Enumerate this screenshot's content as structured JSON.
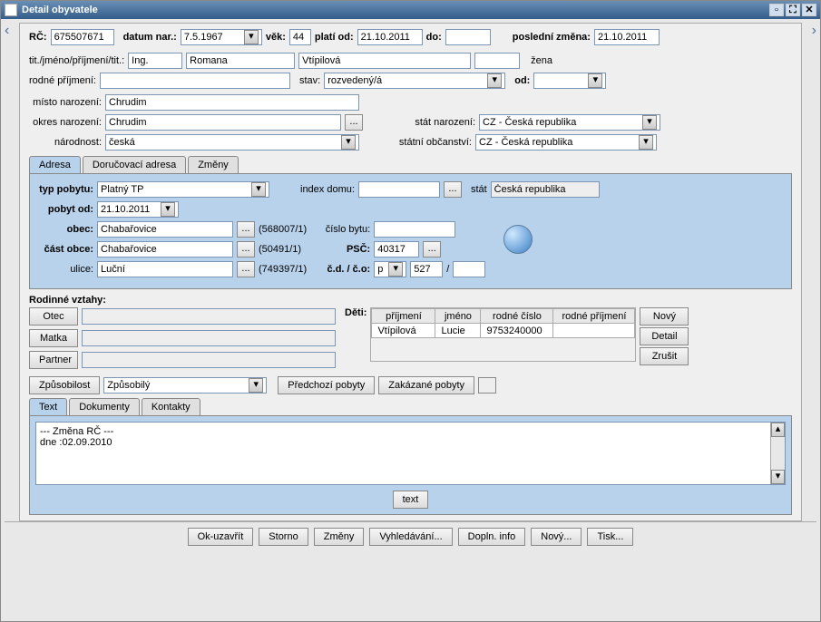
{
  "window": {
    "title": "Detail obyvatele"
  },
  "nav": {
    "left": "‹",
    "right": "›"
  },
  "fields": {
    "rc_label": "RČ:",
    "rc": "675507671",
    "dob_label": "datum nar.:",
    "dob": "7.5.1967",
    "age_label": "věk:",
    "age": "44",
    "valid_from_label": "platí od:",
    "valid_from": "21.10.2011",
    "to_label": "do:",
    "to": "",
    "last_change_label": "poslední změna:",
    "last_change": "21.10.2011",
    "name_label": "tit./jméno/příjmení/tit.:",
    "title_before": "Ing.",
    "first_name": "Romana",
    "surname": "Vtípilová",
    "title_after": "",
    "gender": "žena",
    "maiden_label": "rodné příjmení:",
    "maiden": "",
    "state_label": "stav:",
    "state": "rozvedený/á",
    "state_from_label": "od:",
    "state_from": "",
    "birthplace_label": "místo narození:",
    "birthplace": "Chrudim",
    "birth_district_label": "okres narození:",
    "birth_district": "Chrudim",
    "birth_country_label": "stát narození:",
    "birth_country": "CZ - Česká republika",
    "nationality_label": "národnost:",
    "nationality": "česká",
    "citizenship_label": "státní občanství:",
    "citizenship": "CZ - Česká republika"
  },
  "tabs1": {
    "adresa": "Adresa",
    "dorucovaci": "Doručovací adresa",
    "zmeny": "Změny"
  },
  "addr": {
    "typ_label": "typ pobytu:",
    "typ": "Platný TP",
    "index_label": "index domu:",
    "index": "",
    "stat_label": "stát",
    "stat": "Česká republika",
    "pobyt_od_label": "pobyt od:",
    "pobyt_od": "21.10.2011",
    "obec_label": "obec:",
    "obec": "Chabařovice",
    "obec_code": "(568007/1)",
    "cast_label": "část obce:",
    "cast": "Chabařovice",
    "cast_code": "(50491/1)",
    "ulice_label": "ulice:",
    "ulice": "Luční",
    "ulice_code": "(749397/1)",
    "byt_label": "číslo bytu:",
    "byt": "",
    "psc_label": "PSČ:",
    "psc": "40317",
    "cd_label": "č.d. / č.o:",
    "cd_type": "p",
    "cd": "527",
    "co": ""
  },
  "relations": {
    "title": "Rodinné vztahy:",
    "otec": "Otec",
    "otec_val": "",
    "matka": "Matka",
    "matka_val": "",
    "partner": "Partner",
    "partner_val": "",
    "deti_label": "Děti:",
    "cols": {
      "prijmeni": "příjmení",
      "jmeno": "jméno",
      "rc": "rodné číslo",
      "rodne_prijmeni": "rodné příjmení"
    },
    "rows": [
      {
        "prijmeni": "Vtípilová",
        "jmeno": "Lucie",
        "rc": "9753240000",
        "rodne_prijmeni": ""
      }
    ],
    "novy": "Nový",
    "detail": "Detail",
    "zrusit": "Zrušit"
  },
  "capacity": {
    "zpusobilost_btn": "Způsobilost",
    "zpusobilost": "Způsobilý",
    "prev": "Předchozí pobyty",
    "forbidden": "Zakázané pobyty"
  },
  "tabs2": {
    "text": "Text",
    "dokumenty": "Dokumenty",
    "kontakty": "Kontakty"
  },
  "textarea": {
    "line1": "--- Změna RČ ---",
    "line2": "dne :02.09.2010"
  },
  "text_btn": "text",
  "footer": {
    "ok": "Ok-uzavřít",
    "storno": "Storno",
    "zmeny": "Změny",
    "vyhl": "Vyhledávání...",
    "dopln": "Dopln. info",
    "novy": "Nový...",
    "tisk": "Tisk..."
  }
}
